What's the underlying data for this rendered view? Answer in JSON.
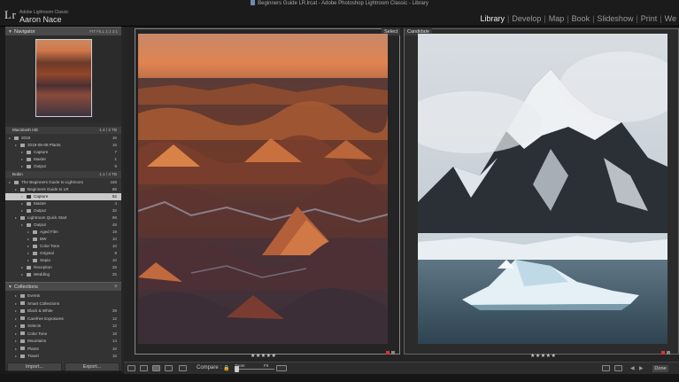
{
  "app": {
    "identity_small": "Adobe Lightroom Classic",
    "identity_name": "Aaron Nace",
    "window_title": "Beginners Guide LR.lrcat - Adobe Photoshop Lightroom Classic - Library",
    "modules": [
      "Library",
      "Develop",
      "Map",
      "Book",
      "Slideshow",
      "Print",
      "We"
    ],
    "active_module": "Library"
  },
  "navigator": {
    "title": "Navigator",
    "zoom_options": "FIT  FILL  1:1  3:1"
  },
  "folders": {
    "volume1": {
      "name": "Macintosh HD",
      "info": "1.4 / 2 TB"
    },
    "volume2": {
      "name": "Bobin",
      "info": "1.1 / 4 TB"
    },
    "rows": [
      {
        "label": "2019",
        "count": "16",
        "indent": 0
      },
      {
        "label": "2019-05-08 Plants",
        "count": "16",
        "indent": 1
      },
      {
        "label": "Capture",
        "count": "7",
        "indent": 2
      },
      {
        "label": "Master",
        "count": "1",
        "indent": 2
      },
      {
        "label": "Output",
        "count": "8",
        "indent": 2
      }
    ],
    "rows2": [
      {
        "label": "The Beginners Guide to Lightroom",
        "count": "186",
        "indent": 0
      },
      {
        "label": "Beginners Guide to LR",
        "count": "88",
        "indent": 1
      },
      {
        "label": "Capture",
        "count": "52",
        "indent": 2,
        "selected": true
      },
      {
        "label": "Master",
        "count": "4",
        "indent": 2
      },
      {
        "label": "Output",
        "count": "32",
        "indent": 2
      },
      {
        "label": "Lightroom Quick Start",
        "count": "98",
        "indent": 1
      },
      {
        "label": "Output",
        "count": "48",
        "indent": 2
      },
      {
        "label": "Aged Film",
        "count": "19",
        "indent": 3
      },
      {
        "label": "BW",
        "count": "10",
        "indent": 3
      },
      {
        "label": "Color Tone",
        "count": "10",
        "indent": 3
      },
      {
        "label": "Original",
        "count": "8",
        "indent": 3
      },
      {
        "label": "Sepia",
        "count": "10",
        "indent": 3
      },
      {
        "label": "Reception",
        "count": "28",
        "indent": 2
      },
      {
        "label": "Wedding",
        "count": "25",
        "indent": 2
      }
    ]
  },
  "collections": {
    "title": "Collections",
    "add_symbol": "+",
    "rows": [
      {
        "label": "Events",
        "count": ""
      },
      {
        "label": "Smart Collections",
        "count": ""
      },
      {
        "label": "Black & White",
        "count": "39"
      },
      {
        "label": "Carefree Exposures",
        "count": "12"
      },
      {
        "label": "Selects",
        "count": "12"
      },
      {
        "label": "Color Tone",
        "count": "18"
      },
      {
        "label": "Mountains",
        "count": "14"
      },
      {
        "label": "Plants",
        "count": "16"
      },
      {
        "label": "Travel",
        "count": "15"
      }
    ]
  },
  "footer": {
    "import_label": "Import...",
    "export_label": "Export..."
  },
  "compare": {
    "select_label": "Select",
    "candidate_label": "Candidate",
    "select_stars": "★★★★★",
    "candidate_stars": "★★★★★"
  },
  "toolbar": {
    "compare_label": "Compare :",
    "zoom_label": "Zoom",
    "zoom_value": "Fit",
    "done_label": "Done"
  }
}
